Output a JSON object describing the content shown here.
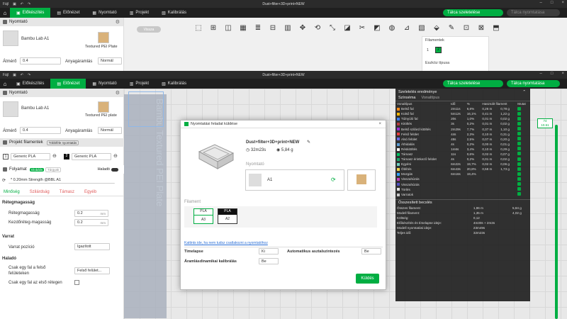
{
  "top_bar": {
    "menu": "Fájl",
    "title": "Dust+filter+3D+print+NEW"
  },
  "nav": {
    "tabs": [
      "Előkészítés",
      "Előnézet",
      "Nyomtató",
      "Projekt",
      "Kalibrálás"
    ],
    "slice_plate": "Tálca szeletelése",
    "print_plate": "Tálca nyomtatása"
  },
  "back_panel": {
    "printer_section": "Nyomtató",
    "printer_name": "Bambu Lab A1",
    "plate_type": "Textured PEI Plate",
    "nozzle_label": "Átmérő",
    "nozzle_value": "0.4",
    "flow_label": "Anyagáramlás",
    "flow_value": "Normál",
    "back_btn": "Vissza",
    "filaments_popup_title": "Filamentek",
    "filament_num": "1",
    "filament_tag": "2",
    "support_type": "Eszköz típusa"
  },
  "left": {
    "printer_section": "Nyomtató",
    "printer_name": "Bambu Lab A1",
    "plate_type": "Textured PEI plate",
    "nozzle_label": "Átmérő",
    "nozzle_value": "0.4",
    "flow_label": "Anyagáramlás",
    "flow_value": "Normál",
    "filament_section": "Projekt filamentek",
    "filament_btn": "Többféle nyomtatás",
    "fil1_num": "1",
    "fil1": "Generic PLA",
    "fil2_num": "2",
    "fil2": "Generic PLA",
    "process_section": "Folyamat",
    "global": "Globális",
    "object": "Tárgyak",
    "advanced": "Haladó",
    "profile": "* 0.20mm Strength @BBL A1",
    "subtabs": [
      "Minőség",
      "Szilárdság",
      "Támasz",
      "Egyéb"
    ],
    "layer_section": "Rétegmagasság",
    "layer_h_label": "Rétegmagasság",
    "layer_h": "0.2",
    "first_layer_label": "Kezdőréteg-magasság",
    "first_layer": "0.2",
    "unit": "mm",
    "seam_section": "Varrat",
    "seam_pos_label": "Varrat pozíció",
    "seam_pos": "Igazított",
    "advanced_section": "Haladó",
    "top_wall_label1": "Csak egy fal a felső",
    "top_wall_label2": "felületeken",
    "top_wall_value": "Felső felület...",
    "first_layer_wall": "Csak egy fal az első rétegen"
  },
  "viewport": {
    "plate_text": "Bambu Textured PEI Plate",
    "layer_top": "74",
    "layer_height": "10.51"
  },
  "results": {
    "title": "Szeletelés eredménye",
    "colorscheme_label": "Színséma",
    "colorscheme": "Vonaltípus",
    "headers": [
      "Vonaltípus",
      "Idő",
      "%",
      "Használt filament",
      "Mutat"
    ],
    "rows": [
      {
        "name": "Belső fal",
        "time": "2m11s",
        "pct": "6,8%",
        "len": "0,26 m",
        "g": "0,78 g",
        "color": "#ff8c1a"
      },
      {
        "name": "Külső fal",
        "time": "5m12s",
        "pct": "16,1%",
        "len": "0,41 m",
        "g": "1,22 g",
        "color": "#ffb700"
      },
      {
        "name": "Túlnyúló fal",
        "time": "20s",
        "pct": "1,0%",
        "len": "0,01 m",
        "g": "0,02 g",
        "color": "#3c7df2"
      },
      {
        "name": "Kitöltés",
        "time": "3s",
        "pct": "0,2%",
        "len": "0,01 m",
        "g": "0,02 g",
        "color": "#b23c3c"
      },
      {
        "name": "Belső szilárd kitöltés",
        "time": "2m29s",
        "pct": "7,7%",
        "len": "0,37 m",
        "g": "1,10 g",
        "color": "#9a2fd4"
      },
      {
        "name": "Felső felület",
        "time": "44s",
        "pct": "2,3%",
        "len": "0,10 m",
        "g": "0,31 g",
        "color": "#e63c3c"
      },
      {
        "name": "Alsó felület",
        "time": "48s",
        "pct": "2,5%",
        "len": "0,07 m",
        "g": "0,20 g",
        "color": "#6a6ae8"
      },
      {
        "name": "Áthidalás",
        "time": "4s",
        "pct": "0,2%",
        "len": "0,00 m",
        "g": "0,01 g",
        "color": "#5a9ad2"
      },
      {
        "name": "Réskitöltés",
        "time": "1m6s",
        "pct": "3,4%",
        "len": "0,10 m",
        "g": "0,29 g",
        "color": "#f2f2f2"
      },
      {
        "name": "Támasz",
        "time": "11s",
        "pct": "0,6%",
        "len": "0,02 m",
        "g": "0,07 g",
        "color": "#00c060"
      },
      {
        "name": "Támasz érintkező felület",
        "time": "4s",
        "pct": "0,2%",
        "len": "0,01 m",
        "g": "0,02 g",
        "color": "#1aa56a"
      },
      {
        "name": "Egyéni",
        "time": "6m22s",
        "pct": "19,7%",
        "len": "0,02 m",
        "g": "0,06 g",
        "color": "#6fd0c0"
      },
      {
        "name": "Öblítés",
        "time": "6m43s",
        "pct": "20,8%",
        "len": "0,58 m",
        "g": "1,73 g",
        "color": "#f0d24a"
      },
      {
        "name": "Mozgás",
        "time": "6m16s",
        "pct": "19,4%",
        "len": "",
        "g": "",
        "color": "#30a0ff"
      },
      {
        "name": "Visszahúzás",
        "time": "",
        "pct": "",
        "len": "",
        "g": "",
        "color": "#c03cc0"
      },
      {
        "name": "Visszahúzás",
        "time": "",
        "pct": "",
        "len": "",
        "g": "",
        "color": "#5050c0"
      },
      {
        "name": "Törlés",
        "time": "",
        "pct": "",
        "len": "",
        "g": "",
        "color": "#e0e0e0"
      },
      {
        "name": "Varratok",
        "time": "",
        "pct": "",
        "len": "",
        "g": "",
        "color": "#c8c8c8"
      }
    ],
    "summary_title": "Összesített becslés",
    "summary": [
      {
        "k": "Összes filament:",
        "v1": "1,96 m",
        "v2": "5,84 g"
      },
      {
        "k": "Modell filament:",
        "v1": "1,35 m",
        "v2": "4,02 g"
      },
      {
        "k": "Költség:",
        "v1": "0,12",
        "v2": ""
      },
      {
        "k": "Előkészítés és tímelapse ideje:",
        "v1": "4m30s + 2m3s",
        "v2": ""
      },
      {
        "k": "Modell nyomtatási ideje:",
        "v1": "23m49s",
        "v2": ""
      },
      {
        "k": "Teljes idő:",
        "v1": "32m23s",
        "v2": ""
      }
    ]
  },
  "dialog": {
    "title": "Nyomtatási feladat küldése",
    "job_name": "Dust+filter+3D+print+NEW",
    "time": "32m23s",
    "weight": "5,84 g",
    "printer_label": "Nyomtató",
    "printer": "A1",
    "filament_label": "Filament",
    "fil1_type": "PLA",
    "fil1_slot": "A3",
    "fil2_type": "PLA",
    "fil2_slot": "A2",
    "link": "Kattints ide, ha nem tudsz csatlakozni a nyomtatóhoz",
    "timelapse_label": "Timelapse",
    "timelapse": "Ki",
    "auto_level_label": "Automatikus asztalszintezés",
    "auto_level": "Be",
    "flow_cal_label": "Áramlásdinamikai kalibrálás",
    "flow_cal": "Be",
    "send_btn": "Küldés"
  }
}
